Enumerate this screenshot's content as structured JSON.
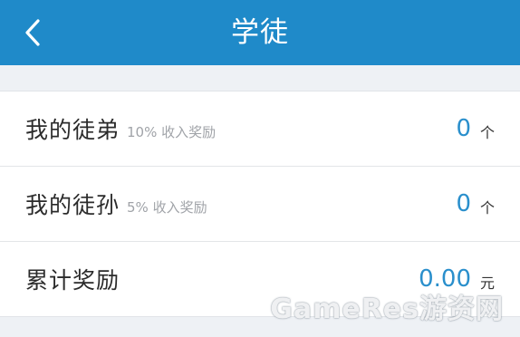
{
  "header": {
    "title": "学徒",
    "back_icon": "chevron-left-icon",
    "background_color": "#1f8ac9"
  },
  "rows": [
    {
      "label": "我的徒弟",
      "sub": "10% 收入奖励",
      "value": "0",
      "unit": "个"
    },
    {
      "label": "我的徒孙",
      "sub": "5% 收入奖励",
      "value": "0",
      "unit": "个"
    },
    {
      "label": "累计奖励",
      "sub": "",
      "value": "0.00",
      "unit": "元"
    }
  ],
  "accent_color": "#2a8fcc",
  "watermark": "GameRes游资网"
}
